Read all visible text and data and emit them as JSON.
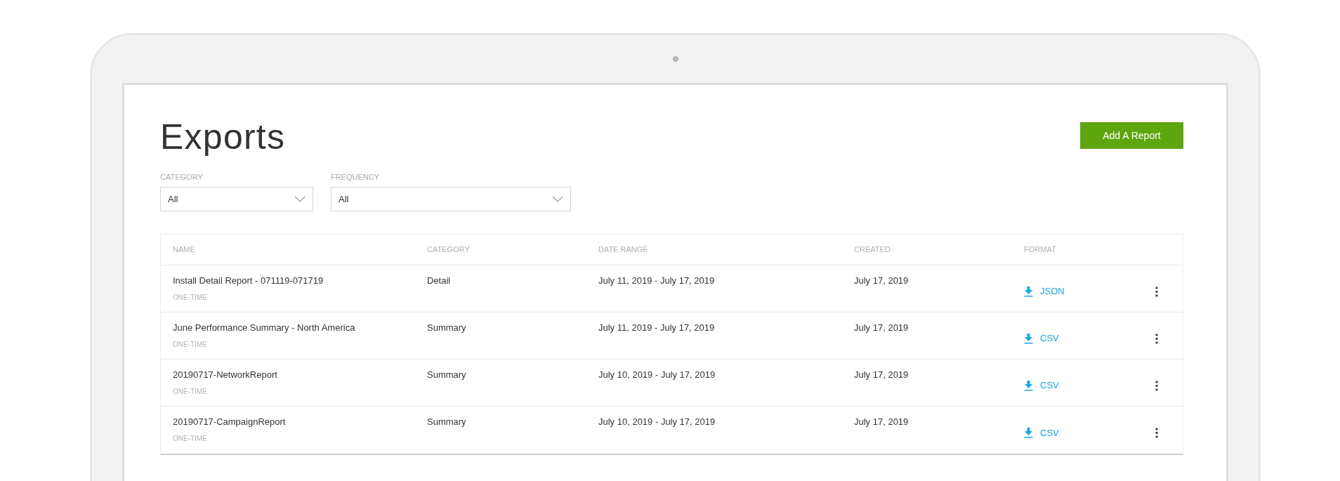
{
  "title": "Exports",
  "add_button": "Add A Report",
  "filters": [
    {
      "label": "CATEGORY",
      "value": "All"
    },
    {
      "label": "FREQUENCY",
      "value": "All"
    }
  ],
  "table": {
    "columns": [
      "NAME",
      "CATEGORY",
      "DATE RANGE",
      "CREATED",
      "FORMAT"
    ],
    "rows": [
      {
        "name": "Install Detail Report - 071119-071719",
        "frequency": "ONE-TIME",
        "category": "Detail",
        "date_range": "July 11, 2019 - July 17, 2019",
        "created": "July 17, 2019",
        "format": "JSON"
      },
      {
        "name": "June Performance Summary - North America",
        "frequency": "ONE-TIME",
        "category": "Summary",
        "date_range": "July 11, 2019 - July 17, 2019",
        "created": "July 17, 2019",
        "format": "CSV"
      },
      {
        "name": "20190717-NetworkReport",
        "frequency": "ONE-TIME",
        "category": "Summary",
        "date_range": "July 10, 2019 - July 17, 2019",
        "created": "July 17, 2019",
        "format": "CSV"
      },
      {
        "name": "20190717-CampaignReport",
        "frequency": "ONE-TIME",
        "category": "Summary",
        "date_range": "July 10, 2019 - July 17, 2019",
        "created": "July 17, 2019",
        "format": "CSV"
      }
    ]
  }
}
